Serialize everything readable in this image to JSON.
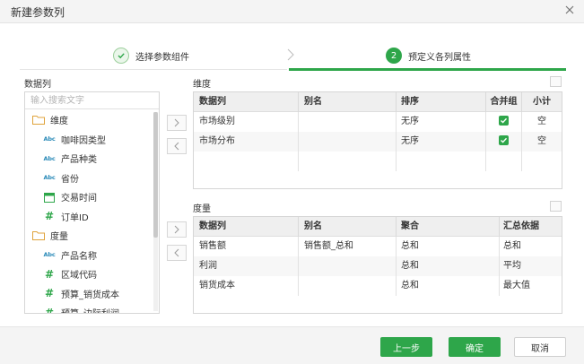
{
  "dialog": {
    "title": "新建参数列"
  },
  "steps": [
    {
      "label": "选择参数组件"
    },
    {
      "num": "2",
      "label": "预定义各列属性"
    }
  ],
  "left": {
    "label": "数据列",
    "search_placeholder": "输入搜索文字",
    "tree": [
      {
        "type": "group",
        "icon": "folder-icon",
        "label": "维度"
      },
      {
        "type": "leaf",
        "icon": "abc-icon",
        "label": "咖啡因类型"
      },
      {
        "type": "leaf",
        "icon": "abc-icon",
        "label": "产品种类"
      },
      {
        "type": "leaf",
        "icon": "abc-icon",
        "label": "省份"
      },
      {
        "type": "leaf",
        "icon": "calendar-icon",
        "label": "交易时间"
      },
      {
        "type": "leaf",
        "icon": "hash-icon",
        "label": "订单ID"
      },
      {
        "type": "group",
        "icon": "folder-icon",
        "label": "度量"
      },
      {
        "type": "leaf",
        "icon": "abc-icon",
        "label": "产品名称"
      },
      {
        "type": "leaf",
        "icon": "hash-icon",
        "label": "区域代码"
      },
      {
        "type": "leaf",
        "icon": "hash-icon",
        "label": "预算_销货成本"
      },
      {
        "type": "leaf",
        "icon": "hash-icon",
        "label": "预算_边际利润"
      }
    ]
  },
  "dimension": {
    "label": "维度",
    "headers": [
      "数据列",
      "别名",
      "排序",
      "合并组",
      "小计"
    ],
    "rows": [
      {
        "col": "市场级别",
        "alias": "",
        "sort": "无序",
        "merge": true,
        "subtotal": "空"
      },
      {
        "col": "市场分布",
        "alias": "",
        "sort": "无序",
        "merge": true,
        "subtotal": "空"
      }
    ]
  },
  "measure": {
    "label": "度量",
    "headers": [
      "数据列",
      "别名",
      "聚合",
      "汇总依据"
    ],
    "rows": [
      {
        "col": "销售额",
        "alias": "销售额_总和",
        "agg": "总和",
        "summary": "总和"
      },
      {
        "col": "利润",
        "alias": "",
        "agg": "总和",
        "summary": "平均"
      },
      {
        "col": "销货成本",
        "alias": "",
        "agg": "总和",
        "summary": "最大值"
      }
    ]
  },
  "footer": {
    "prev": "上一步",
    "ok": "确定",
    "cancel": "取消"
  },
  "colors": {
    "accent": "#2ea64a"
  }
}
